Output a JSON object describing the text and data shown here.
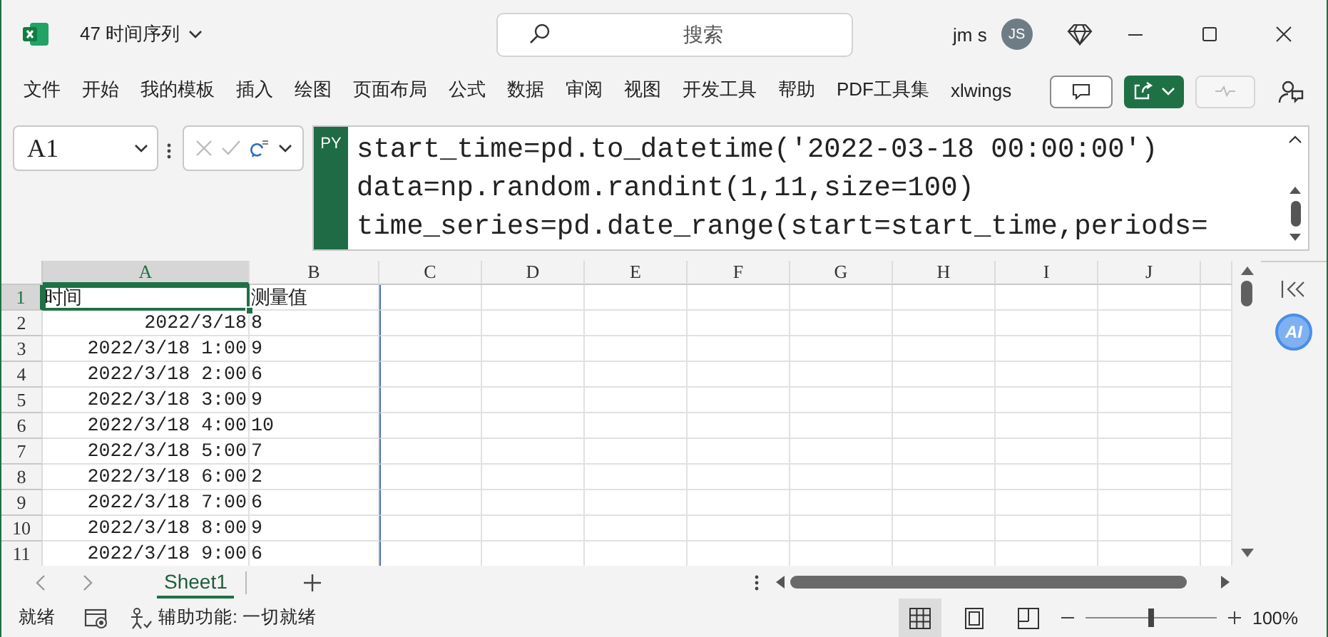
{
  "window": {
    "title": "47 时间序列",
    "search_placeholder": "搜索",
    "user_name": "jm s",
    "avatar_initials": "JS"
  },
  "ribbon_tabs": [
    {
      "label": "文件",
      "selected": false
    },
    {
      "label": "开始",
      "selected": false
    },
    {
      "label": "我的模板",
      "selected": false
    },
    {
      "label": "插入",
      "selected": false
    },
    {
      "label": "绘图",
      "selected": false
    },
    {
      "label": "页面布局",
      "selected": false
    },
    {
      "label": "公式",
      "selected": false
    },
    {
      "label": "数据",
      "selected": false
    },
    {
      "label": "审阅",
      "selected": false
    },
    {
      "label": "视图",
      "selected": false
    },
    {
      "label": "开发工具",
      "selected": false
    },
    {
      "label": "帮助",
      "selected": false
    },
    {
      "label": "PDF工具集",
      "selected": false
    },
    {
      "label": "xlwings",
      "selected": false
    }
  ],
  "name_box": "A1",
  "formula": {
    "badge": "PY",
    "lines": [
      "start_time=pd.to_datetime('2022-03-18 00:00:00')",
      "data=np.random.randint(1,11,size=100)",
      "time_series=pd.date_range(start=start_time,periods="
    ]
  },
  "sheet": {
    "columns": [
      {
        "label": "A",
        "selected": true
      },
      {
        "label": "B",
        "selected": false
      },
      {
        "label": "C",
        "selected": false
      },
      {
        "label": "D",
        "selected": false
      },
      {
        "label": "E",
        "selected": false
      },
      {
        "label": "F",
        "selected": false
      },
      {
        "label": "G",
        "selected": false
      },
      {
        "label": "H",
        "selected": false
      },
      {
        "label": "I",
        "selected": false
      },
      {
        "label": "J",
        "selected": false
      }
    ],
    "rows": [
      {
        "number": "1",
        "selected": true,
        "cells": [
          {
            "kind": "text",
            "text": "时间",
            "selected": true
          },
          {
            "kind": "text",
            "text": "测量值",
            "selected": false
          }
        ]
      },
      {
        "number": "2",
        "selected": false,
        "cells": [
          {
            "kind": "date",
            "text": "2022/3/18",
            "selected": false
          },
          {
            "kind": "text",
            "text": "8",
            "selected": false
          }
        ]
      },
      {
        "number": "3",
        "selected": false,
        "cells": [
          {
            "kind": "date",
            "text": "2022/3/18 1:00",
            "selected": false
          },
          {
            "kind": "text",
            "text": "9",
            "selected": false
          }
        ]
      },
      {
        "number": "4",
        "selected": false,
        "cells": [
          {
            "kind": "date",
            "text": "2022/3/18 2:00",
            "selected": false
          },
          {
            "kind": "text",
            "text": "6",
            "selected": false
          }
        ]
      },
      {
        "number": "5",
        "selected": false,
        "cells": [
          {
            "kind": "date",
            "text": "2022/3/18 3:00",
            "selected": false
          },
          {
            "kind": "text",
            "text": "9",
            "selected": false
          }
        ]
      },
      {
        "number": "6",
        "selected": false,
        "cells": [
          {
            "kind": "date",
            "text": "2022/3/18 4:00",
            "selected": false
          },
          {
            "kind": "text",
            "text": "10",
            "selected": false
          }
        ]
      },
      {
        "number": "7",
        "selected": false,
        "cells": [
          {
            "kind": "date",
            "text": "2022/3/18 5:00",
            "selected": false
          },
          {
            "kind": "text",
            "text": "7",
            "selected": false
          }
        ]
      },
      {
        "number": "8",
        "selected": false,
        "cells": [
          {
            "kind": "date",
            "text": "2022/3/18 6:00",
            "selected": false
          },
          {
            "kind": "text",
            "text": "2",
            "selected": false
          }
        ]
      },
      {
        "number": "9",
        "selected": false,
        "cells": [
          {
            "kind": "date",
            "text": "2022/3/18 7:00",
            "selected": false
          },
          {
            "kind": "text",
            "text": "6",
            "selected": false
          }
        ]
      },
      {
        "number": "10",
        "selected": false,
        "cells": [
          {
            "kind": "date",
            "text": "2022/3/18 8:00",
            "selected": false
          },
          {
            "kind": "text",
            "text": "9",
            "selected": false
          }
        ]
      },
      {
        "number": "11",
        "selected": false,
        "cells": [
          {
            "kind": "date",
            "text": "2022/3/18 9:00",
            "selected": false
          },
          {
            "kind": "text",
            "text": "6",
            "selected": false
          }
        ]
      }
    ]
  },
  "side_pane": {
    "ai_label": "AI"
  },
  "sheet_tabs": [
    {
      "label": "Sheet1",
      "selected": true
    }
  ],
  "status_bar": {
    "ready": "就绪",
    "accessibility": "辅助功能: 一切就绪",
    "view_buttons": [
      {
        "kind": "normal",
        "selected": true
      },
      {
        "kind": "page_layout",
        "selected": false
      },
      {
        "kind": "page_break",
        "selected": false
      }
    ],
    "zoom": {
      "level": 0.5,
      "reading": "100%"
    }
  }
}
